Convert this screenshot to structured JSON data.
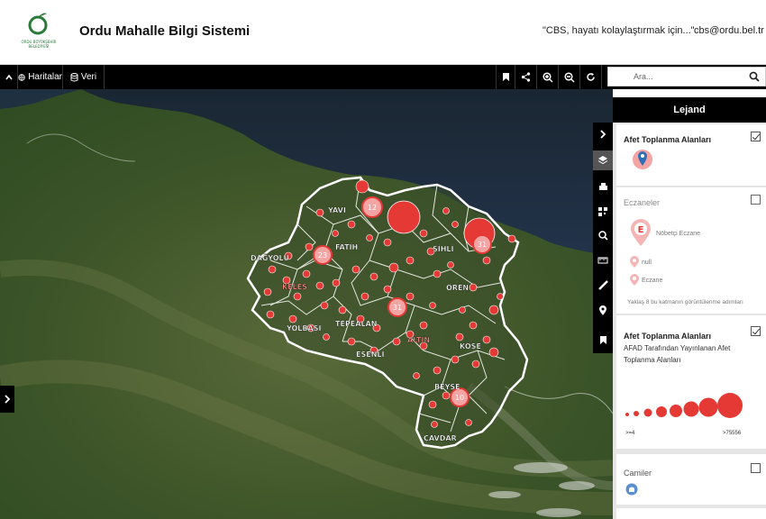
{
  "header": {
    "logo_text": "ORDU BÜYÜKŞEHİR BELEDİYESİ",
    "title": "Ordu Mahalle Bilgi Sistemi",
    "slogan": "\"CBS, hayatı kolaylaştırmak için...\"",
    "email": "cbs@ordu.bel.tr"
  },
  "toolbar": {
    "collapse_icon": "chevron-up-icon",
    "maps_label": "Haritalar",
    "data_label": "Veri",
    "tools": [
      "bookmark-icon",
      "share-icon",
      "zoom-in-icon",
      "zoom-out-icon",
      "refresh-icon"
    ],
    "search_placeholder": "Ara..."
  },
  "map": {
    "place_labels": [
      "DAĞYOLU",
      "YAVI",
      "FATİH",
      "ŞİHLİ",
      "ÖREN",
      "TEPEALAN",
      "YOLBAŞI",
      "ESENLİ",
      "KÖŞE",
      "BEYSE",
      "ÇAVDAR",
      "ALTIN",
      "KELES"
    ],
    "cluster_counts": [
      "12",
      "23",
      "31",
      "31",
      "10"
    ],
    "colors": {
      "water": "#1d2a38",
      "land": "#3d5a2a",
      "boundary": "#ffffff",
      "marker": "#e53935"
    }
  },
  "right_tools": [
    "chevron-right-icon",
    "layers-icon",
    "print-icon",
    "qr-icon",
    "zoom-icon",
    "measure-icon",
    "ruler-icon",
    "location-icon",
    "bookmark-icon"
  ],
  "legend": {
    "title": "Lejand",
    "cards": [
      {
        "title": "Afet Toplanma Alanları",
        "checked": true
      },
      {
        "title": "Eczaneler",
        "checked": false,
        "items": [
          "Nöbetçi Eczane",
          "null",
          "Eczane"
        ],
        "note": "Yaklaş 8 bu katmanın görüntülenme adımları"
      },
      {
        "title": "Afet Toplanma Alanları",
        "checked": true,
        "subtitle": "AFAD Tarafından Yayınlanan Afet Toplanma Alanları",
        "min_label": ">=4",
        "max_label": ">75556"
      },
      {
        "title": "Camiler",
        "checked": false
      }
    ]
  }
}
